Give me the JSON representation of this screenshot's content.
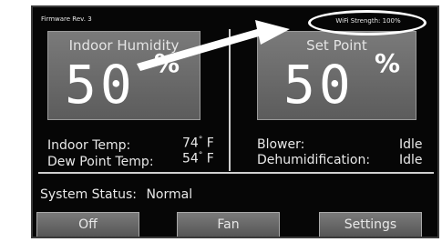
{
  "firmware": "Firmware Rev. 3",
  "wifi": "WiFi Strength: 100%",
  "indoor_humidity": {
    "title": "Indoor Humidity",
    "value": "50",
    "unit": "%"
  },
  "set_point": {
    "title": "Set Point",
    "value": "50",
    "unit": "%"
  },
  "readings": {
    "indoor_temp_label": "Indoor Temp:",
    "indoor_temp_value": "74",
    "indoor_temp_unit": "F",
    "dew_point_label": "Dew Point Temp:",
    "dew_point_value": "54",
    "dew_point_unit": "F",
    "blower_label": "Blower:",
    "blower_value": "Idle",
    "dehum_label": "Dehumidification:",
    "dehum_value": "Idle"
  },
  "status": {
    "label": "System Status:",
    "value": "Normal"
  },
  "buttons": {
    "off": "Off",
    "fan": "Fan",
    "settings": "Settings"
  },
  "degree": "°",
  "colors": {
    "screen_bg": "#060606",
    "panel": "#6a6a6a",
    "annotation": "#ffffff"
  }
}
